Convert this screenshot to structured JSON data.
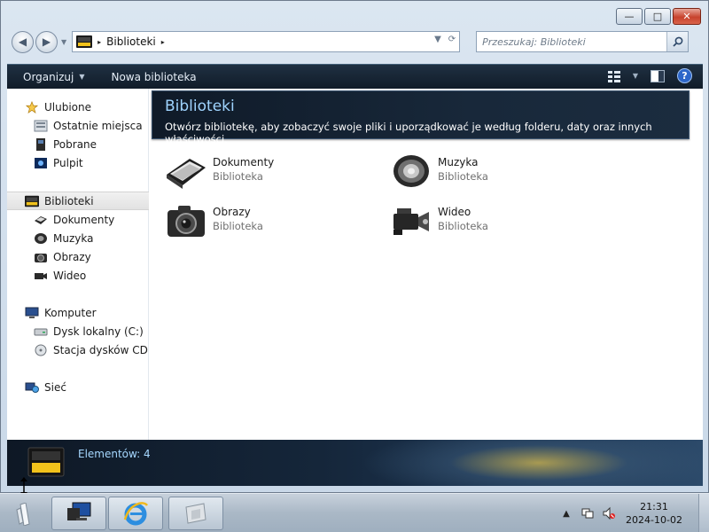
{
  "window": {
    "caption": {
      "minimize": "—",
      "maximize": "□",
      "close": "✕"
    }
  },
  "address": {
    "path": [
      "Biblioteki"
    ],
    "arrow": "▸",
    "refresh_icon": "refresh-icon"
  },
  "search": {
    "placeholder": "Przeszukaj: Biblioteki"
  },
  "command_bar": {
    "organize": "Organizuj",
    "new_library": "Nowa biblioteka",
    "help": "?"
  },
  "nav": {
    "favorites": {
      "label": "Ulubione",
      "items": [
        {
          "label": "Ostatnie miejsca",
          "icon": "recent-places-icon"
        },
        {
          "label": "Pobrane",
          "icon": "downloads-icon"
        },
        {
          "label": "Pulpit",
          "icon": "desktop-icon"
        }
      ]
    },
    "libraries": {
      "label": "Biblioteki",
      "items": [
        {
          "label": "Dokumenty",
          "icon": "documents-icon"
        },
        {
          "label": "Muzyka",
          "icon": "music-icon"
        },
        {
          "label": "Obrazy",
          "icon": "pictures-icon"
        },
        {
          "label": "Wideo",
          "icon": "video-icon"
        }
      ]
    },
    "computer": {
      "label": "Komputer",
      "items": [
        {
          "label": "Dysk lokalny (C:)",
          "icon": "local-disk-icon"
        },
        {
          "label": "Stacja dysków CD (D:)",
          "icon": "cd-drive-icon"
        }
      ]
    },
    "network": {
      "label": "Sieć"
    }
  },
  "content": {
    "title": "Biblioteki",
    "description": "Otwórz bibliotekę, aby zobaczyć swoje pliki i uporządkować je według folderu, daty oraz innych właściwości.",
    "libraries": [
      {
        "name": "Dokumenty",
        "type": "Biblioteka",
        "icon": "documents-library-icon"
      },
      {
        "name": "Muzyka",
        "type": "Biblioteka",
        "icon": "music-library-icon"
      },
      {
        "name": "Obrazy",
        "type": "Biblioteka",
        "icon": "pictures-library-icon"
      },
      {
        "name": "Wideo",
        "type": "Biblioteka",
        "icon": "video-library-icon"
      }
    ]
  },
  "details": {
    "count_text": "Elementów: 4"
  },
  "taskbar": {
    "clock_time": "21:31",
    "clock_date": "2024-10-02",
    "tray_show_hidden": "▲"
  },
  "colors": {
    "header_title": "#9fd4ff",
    "command_bar": "#1a2838",
    "details_text": "#a6d8ff"
  }
}
